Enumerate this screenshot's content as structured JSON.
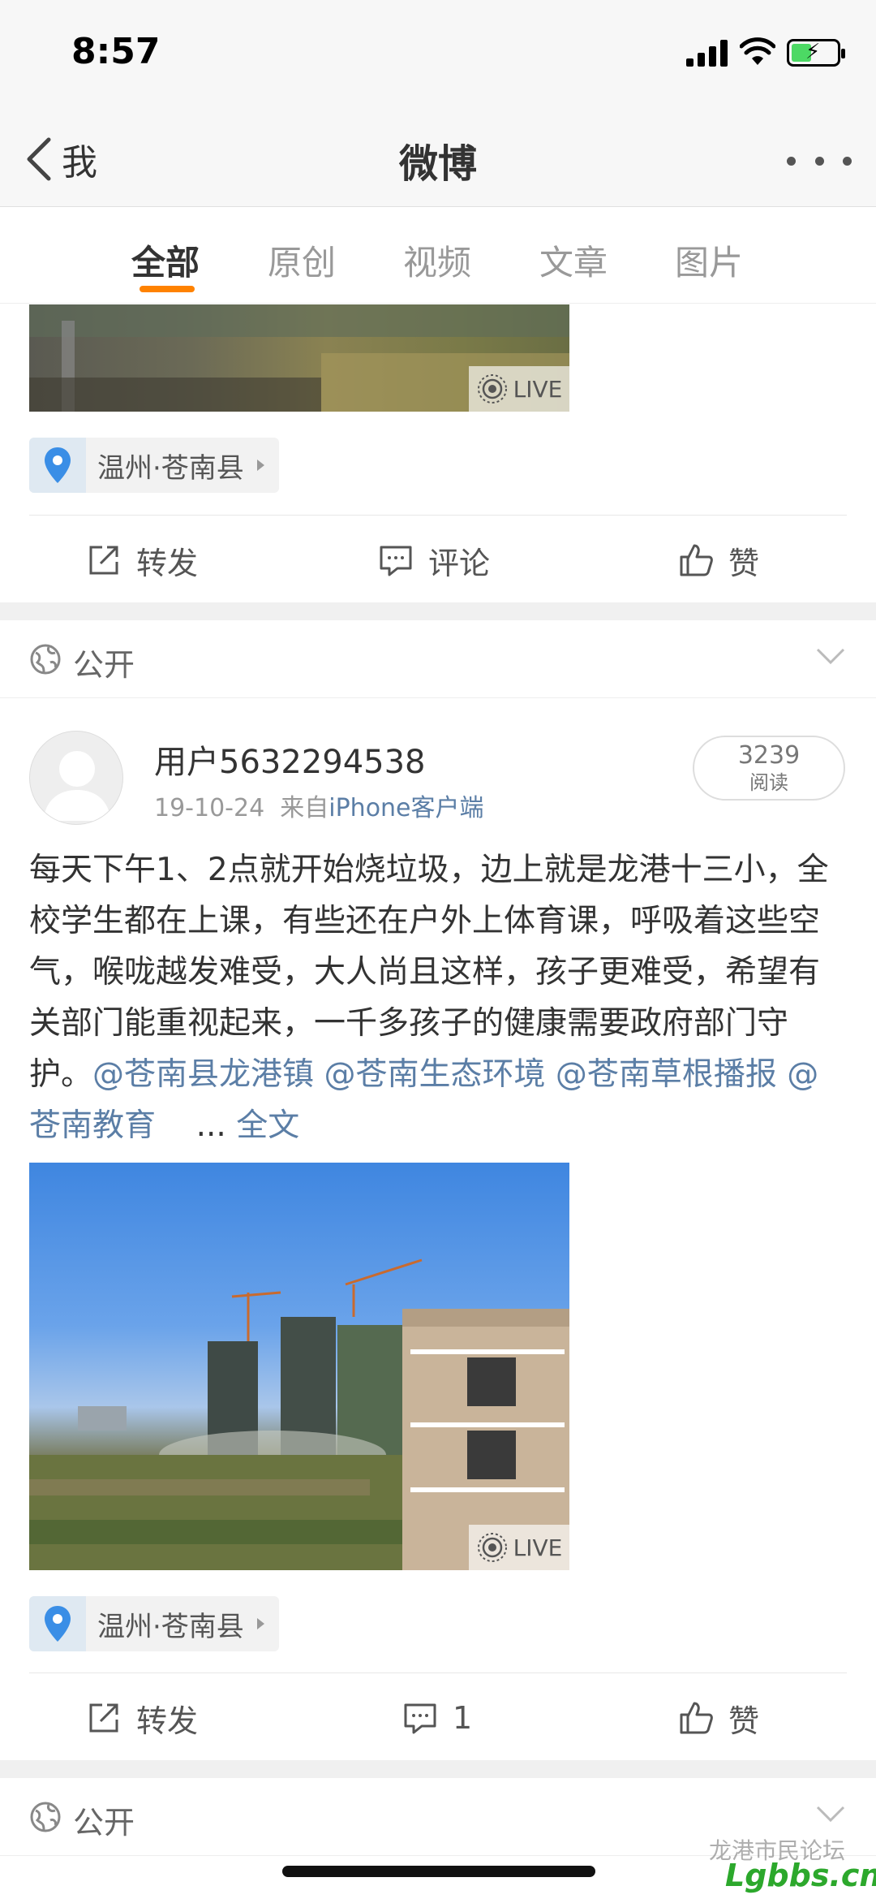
{
  "status_bar": {
    "time": "8:57"
  },
  "nav": {
    "back_label": "我",
    "title": "微博"
  },
  "tabs": [
    {
      "label": "全部",
      "active": true
    },
    {
      "label": "原创",
      "active": false
    },
    {
      "label": "视频",
      "active": false
    },
    {
      "label": "文章",
      "active": false
    },
    {
      "label": "图片",
      "active": false
    }
  ],
  "prev_post": {
    "live_label": "LIVE",
    "location": "温州·苍南县",
    "actions": {
      "repost": "转发",
      "comment": "评论",
      "like": "赞"
    }
  },
  "visibility_label": "公开",
  "post": {
    "username": "用户5632294538",
    "date": "19-10-24",
    "source_prefix": "来自",
    "source": "iPhone客户端",
    "read_count": "3239",
    "read_label": "阅读",
    "text": "每天下午1、2点就开始烧垃圾，边上就是龙港十三小，全校学生都在上课，有些还在户外上体育课，呼吸着这些空气，喉咙越发难受，大人尚且这样，孩子更难受，希望有关部门能重视起来，一千多孩子的健康需要政府部门守护。",
    "mentions": [
      "@苍南县龙港镇",
      "@苍南生态环境",
      "@苍南草根播报",
      "@苍南教育"
    ],
    "ellipsis": "...",
    "full_text_label": "全文",
    "live_label": "LIVE",
    "location": "温州·苍南县",
    "actions": {
      "repost": "转发",
      "comment": "1",
      "like": "赞"
    }
  },
  "next_visibility_label": "公开",
  "watermark": {
    "text": "龙港市民论坛",
    "brand": "Lgbbs.cn"
  },
  "colors": {
    "accent": "#ff8200",
    "link": "#5b7ea6"
  }
}
